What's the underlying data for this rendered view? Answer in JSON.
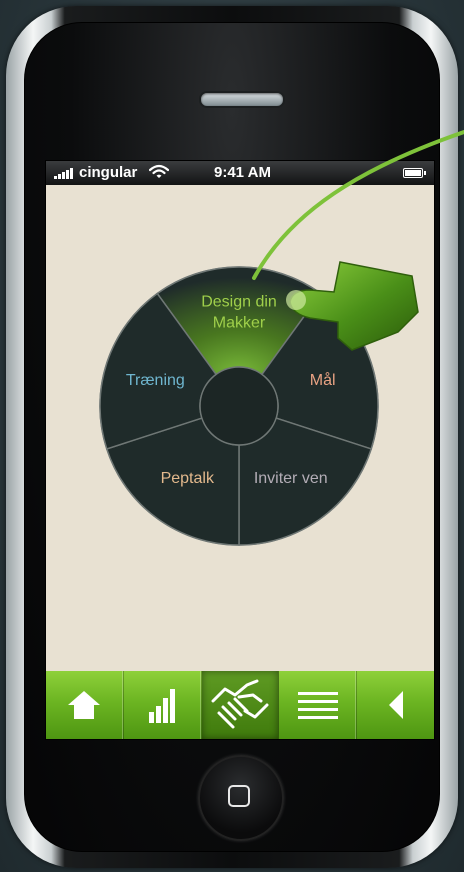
{
  "status_bar": {
    "carrier": "cingular",
    "time": "9:41 AM",
    "signal_bars": 5,
    "battery_level": 1.0
  },
  "wheel_menu": {
    "items": [
      {
        "id": "design",
        "label_lines": [
          "Design din",
          "Makker"
        ],
        "color": "#9fcf4a",
        "selected": true
      },
      {
        "id": "goal",
        "label_lines": [
          "Mål"
        ],
        "color": "#e8a283",
        "selected": false
      },
      {
        "id": "invite",
        "label_lines": [
          "Inviter ven"
        ],
        "color": "#b3adb6",
        "selected": false
      },
      {
        "id": "peptalk",
        "label_lines": [
          "Peptalk"
        ],
        "color": "#e3b98d",
        "selected": false
      },
      {
        "id": "training",
        "label_lines": [
          "Træning"
        ],
        "color": "#6fb6cf",
        "selected": false
      }
    ]
  },
  "toolbar": {
    "items": [
      {
        "icon": "home-icon",
        "active": false
      },
      {
        "icon": "bar-chart-icon",
        "active": false
      },
      {
        "icon": "handshake-icon",
        "active": true
      },
      {
        "icon": "list-icon",
        "active": false
      },
      {
        "icon": "back-arrow-icon",
        "active": false
      }
    ]
  },
  "colors": {
    "toolbar_green": "#6cb522",
    "wheel_dark": "#1f2b2a",
    "screen_bg": "#e8e1d2",
    "highlight_green": "#7ec23a"
  }
}
